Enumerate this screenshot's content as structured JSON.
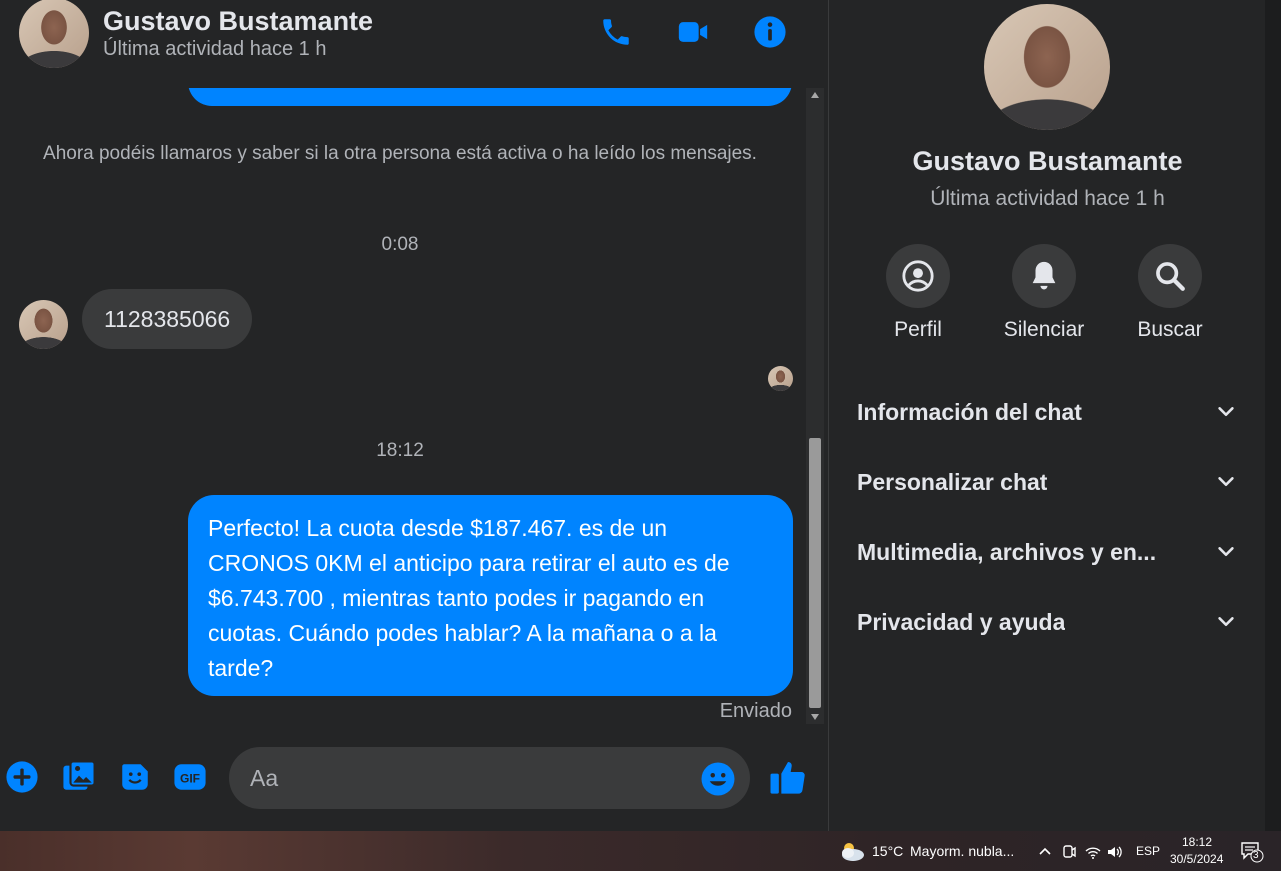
{
  "header": {
    "name": "Gustavo Bustamante",
    "status": "Última actividad hace 1 h"
  },
  "messages": {
    "system_note": "Ahora podéis llamaros y saber si la otra persona está activa o ha leído los mensajes.",
    "time_1": "0:08",
    "incoming_text": "1128385066",
    "time_2": "18:12",
    "outgoing_text": "Perfecto! La cuota desde $187.467. es de un CRONOS 0KM el anticipo para retirar el auto es de $6.743.700 , mientras tanto podes ir pagando en cuotas. Cuándo podes hablar? A la mañana o a la tarde?",
    "sent_label": "Enviado"
  },
  "composer": {
    "placeholder": "Aa"
  },
  "info": {
    "name": "Gustavo Bustamante",
    "status": "Última actividad hace 1 h",
    "actions": [
      {
        "label": "Perfil",
        "icon": "profile-icon"
      },
      {
        "label": "Silenciar",
        "icon": "bell-icon"
      },
      {
        "label": "Buscar",
        "icon": "search-icon"
      }
    ],
    "sections": [
      "Información del chat",
      "Personalizar chat",
      "Multimedia, archivos y en...",
      "Privacidad y ayuda"
    ]
  },
  "taskbar": {
    "weather": "15°C",
    "forecast": "Mayorm. nubla...",
    "language": "ESP",
    "time": "18:12",
    "date": "30/5/2024",
    "notifications": "3"
  },
  "colors": {
    "accent": "#0084ff",
    "background": "#242526",
    "bubble_incoming": "#3a3b3c"
  }
}
